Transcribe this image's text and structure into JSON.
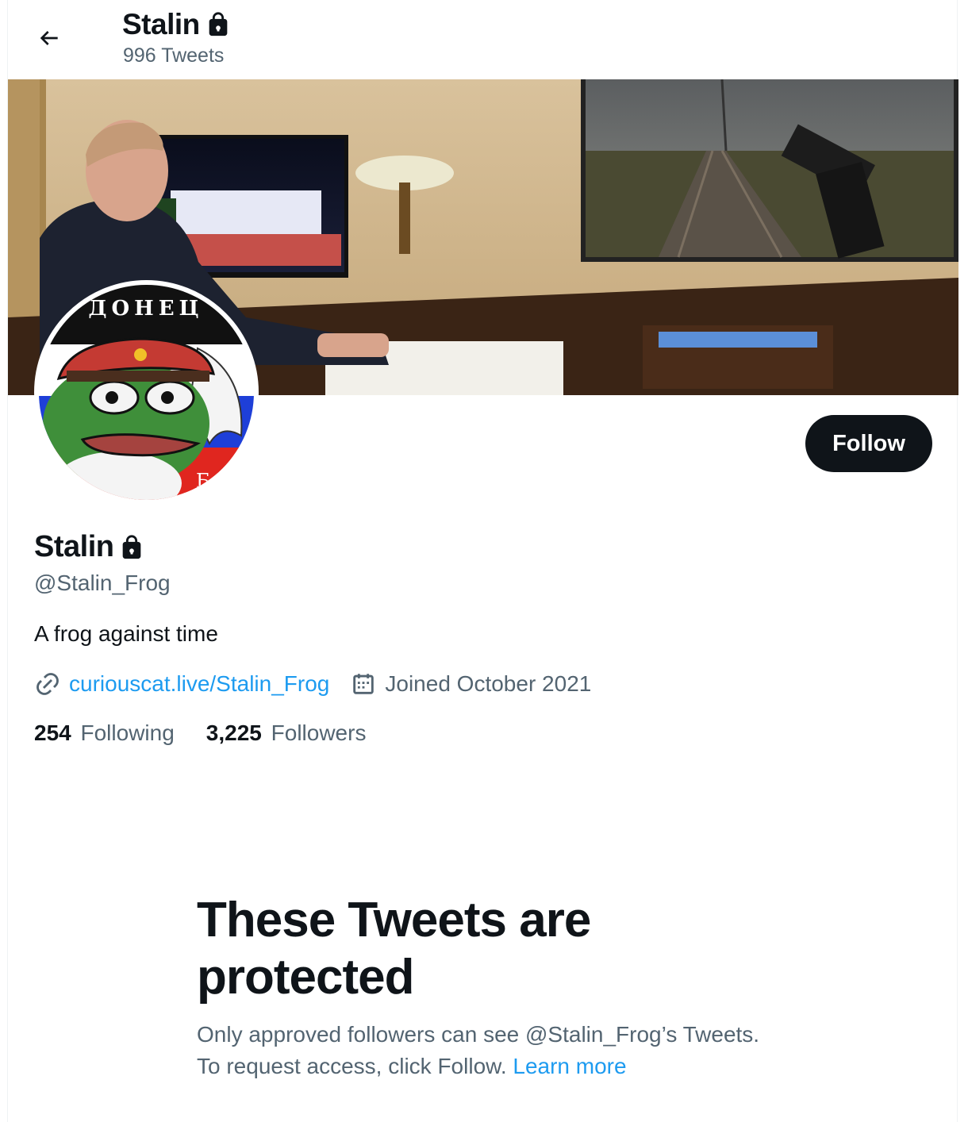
{
  "header": {
    "display_name": "Stalin",
    "tweet_count": "996 Tweets"
  },
  "profile": {
    "display_name": "Stalin",
    "handle": "@Stalin_Frog",
    "bio": "A frog against time",
    "website": "curiouscat.live/Stalin_Frog",
    "joined": "Joined October 2021",
    "following_count": "254",
    "following_label": "Following",
    "followers_count": "3,225",
    "followers_label": "Followers",
    "avatar_text_top": "ДОНЕЦ",
    "avatar_text_bottom": "Б"
  },
  "actions": {
    "follow_label": "Follow"
  },
  "protected_notice": {
    "title": "These Tweets are protected",
    "body": "Only approved followers can see @Stalin_Frog’s Tweets. To request access, click Follow. ",
    "learn_more": "Learn more"
  },
  "colors": {
    "accent": "#1d9bf0",
    "text_primary": "#0f1419",
    "text_secondary": "#536471"
  },
  "icons": [
    "back-arrow-icon",
    "lock-icon",
    "link-icon",
    "calendar-icon"
  ]
}
